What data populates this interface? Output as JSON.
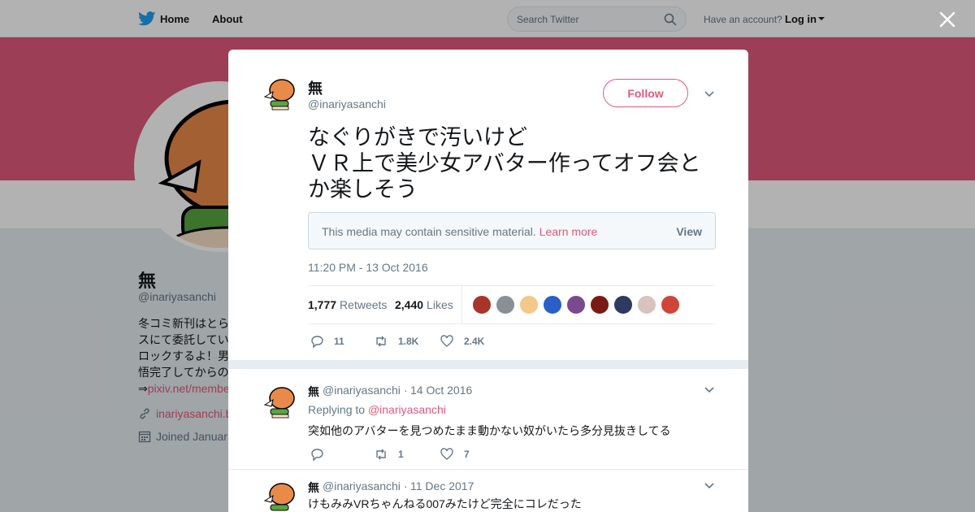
{
  "colors": {
    "accent": "#e0597a",
    "twitter_blue": "#1da1f2",
    "text": "#14171a",
    "muted": "#657786",
    "banner": "#e0597a"
  },
  "topbar": {
    "home_label": "Home",
    "about_label": "About",
    "search_placeholder": "Search Twitter",
    "have_account": "Have an account?",
    "login_label": "Log in"
  },
  "profile": {
    "name": "無",
    "handle": "@inariyasanchi",
    "bio_lines": [
      "冬コミ新刊はとら",
      "スにて委託してい",
      "ロックするよ！男",
      "悟完了してからの"
    ],
    "bio_link_prefix": "⇒",
    "bio_link": "pixiv.net/membe",
    "website": "inariyasanchi.b",
    "joined": "Joined Januar"
  },
  "tweet": {
    "author_name": "無",
    "author_handle": "@inariyasanchi",
    "follow_label": "Follow",
    "text": "なぐりがきで汚いけど\nＶＲ上で美少女アバター作ってオフ会とか楽しそう",
    "sensitive_message": "This media may contain sensitive material.",
    "sensitive_learn": "Learn more",
    "sensitive_view": "View",
    "timestamp": "11:20 PM - 13 Oct 2016",
    "retweets_count": "1,777",
    "retweets_label": "Retweets",
    "likes_count": "2,440",
    "likes_label": "Likes",
    "actions": {
      "replies": "11",
      "retweets": "1.8K",
      "likes": "2.4K"
    }
  },
  "replies": [
    {
      "name": "無",
      "handle": "@inariyasanchi",
      "dot": "·",
      "date": "14 Oct 2016",
      "replying_to_label": "Replying to",
      "replying_to_handle": "@inariyasanchi",
      "text": "突如他のアバターを見つめたまま動かない奴がいたら多分見抜きしてる",
      "replies": "",
      "retweets": "1",
      "likes": "7"
    },
    {
      "name": "無",
      "handle": "@inariyasanchi",
      "dot": "·",
      "date": "11 Dec 2017",
      "text": "けもみみVRちゃんねる007みたけど完全にコレだった"
    }
  ]
}
